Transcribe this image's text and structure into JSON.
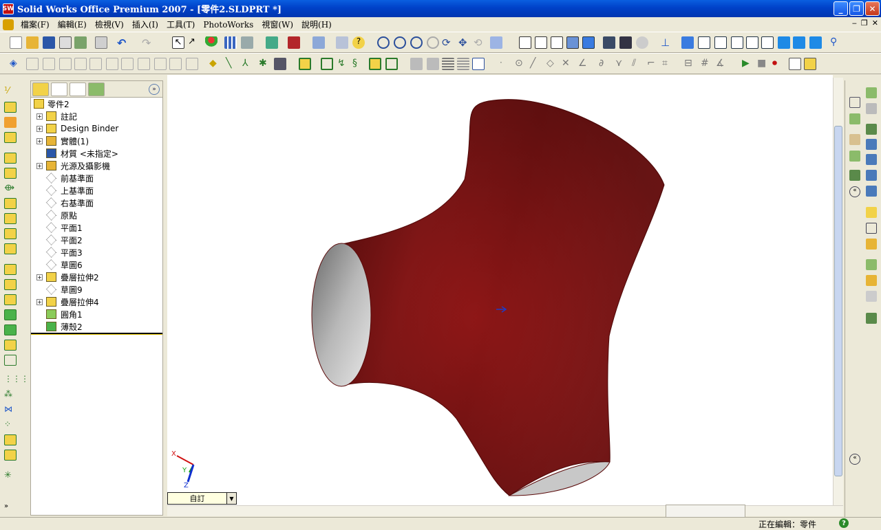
{
  "window": {
    "app_icon_text": "SW",
    "title": "Solid Works Office Premium 2007 - [零件2.SLDPRT *]"
  },
  "menu": {
    "items": [
      "檔案(F)",
      "編輯(E)",
      "檢視(V)",
      "插入(I)",
      "工具(T)",
      "PhotoWorks",
      "視窗(W)",
      "說明(H)"
    ]
  },
  "feature_tree": {
    "root": "零件2",
    "items": [
      {
        "label": "註記",
        "expand": "+",
        "icon": "annotations-icon"
      },
      {
        "label": "Design Binder",
        "expand": "+",
        "icon": "design-binder-icon"
      },
      {
        "label": "實體(1)",
        "expand": "+",
        "icon": "solid-bodies-icon"
      },
      {
        "label": "材質 <未指定>",
        "expand": "",
        "icon": "material-icon"
      },
      {
        "label": "光源及攝影機",
        "expand": "+",
        "icon": "lights-cameras-icon"
      },
      {
        "label": "前基準面",
        "expand": "",
        "icon": "plane-icon"
      },
      {
        "label": "上基準面",
        "expand": "",
        "icon": "plane-icon"
      },
      {
        "label": "右基準面",
        "expand": "",
        "icon": "plane-icon"
      },
      {
        "label": "原點",
        "expand": "",
        "icon": "origin-icon"
      },
      {
        "label": "平面1",
        "expand": "",
        "icon": "plane-icon"
      },
      {
        "label": "平面2",
        "expand": "",
        "icon": "plane-icon"
      },
      {
        "label": "平面3",
        "expand": "",
        "icon": "plane-icon"
      },
      {
        "label": "草圖6",
        "expand": "",
        "icon": "sketch-icon"
      },
      {
        "label": "疊層拉伸2",
        "expand": "+",
        "icon": "loft-icon"
      },
      {
        "label": "草圖9",
        "expand": "",
        "icon": "sketch-icon"
      },
      {
        "label": "疊層拉伸4",
        "expand": "+",
        "icon": "loft-icon"
      },
      {
        "label": "圓角1",
        "expand": "",
        "icon": "fillet-icon"
      },
      {
        "label": "薄殼2",
        "expand": "",
        "icon": "shell-icon"
      }
    ]
  },
  "viewport": {
    "view_orientation": "自訂",
    "triad": {
      "x": "X",
      "y": "Y",
      "z": "Z"
    },
    "model_color": "#8c1616"
  },
  "status": {
    "text": "正在編輯：零件",
    "help": "?"
  },
  "colors": {
    "title_bar": "#0a5fe0",
    "chrome": "#ece9d8",
    "model": "#8c1616"
  }
}
